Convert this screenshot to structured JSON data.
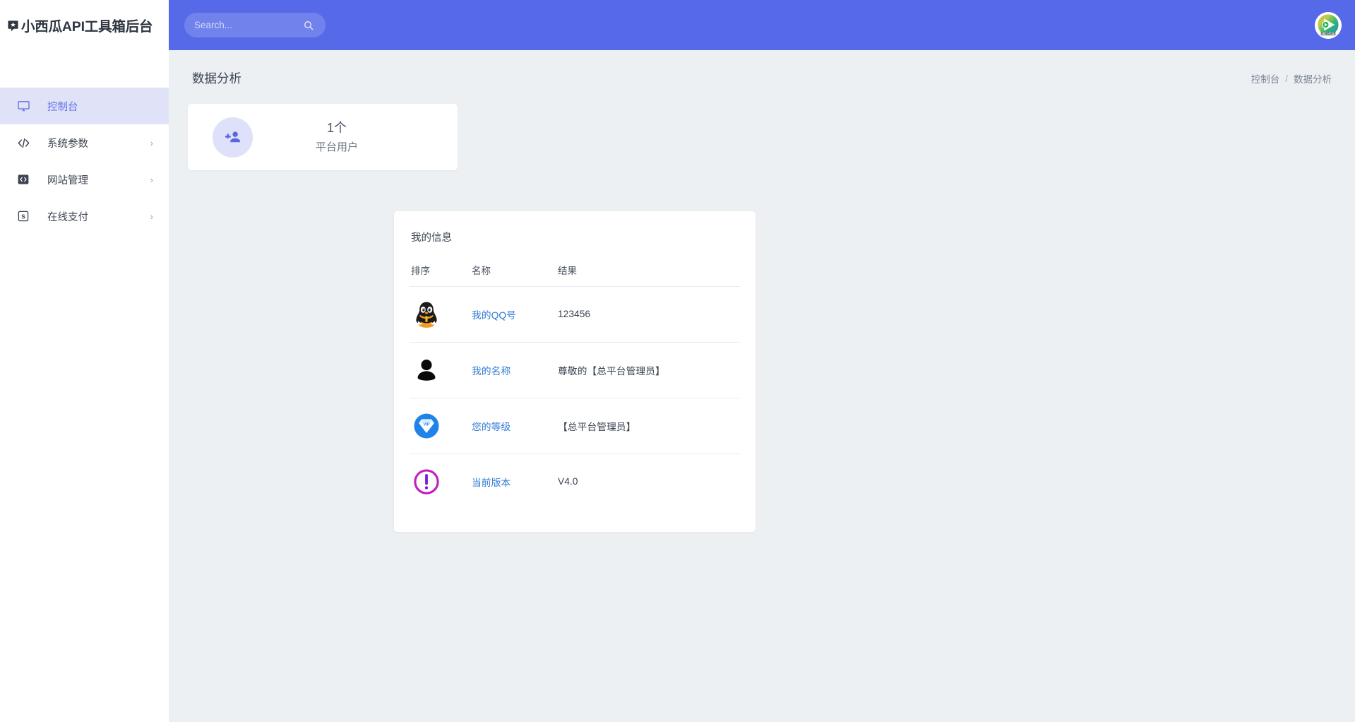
{
  "brand": {
    "title": "小西瓜API工具箱后台",
    "icon": "chat-star-icon"
  },
  "sidebar": {
    "items": [
      {
        "label": "控制台",
        "icon": "monitor-icon",
        "active": true,
        "has_arrow": false
      },
      {
        "label": "系统参数",
        "icon": "code-brackets-icon",
        "active": false,
        "has_arrow": true,
        "arrow": "›"
      },
      {
        "label": "网站管理",
        "icon": "code-box-filled-icon",
        "active": false,
        "has_arrow": true,
        "arrow": "›"
      },
      {
        "label": "在线支付",
        "icon": "currency-box-icon",
        "active": false,
        "has_arrow": true,
        "arrow": "›"
      }
    ]
  },
  "topbar": {
    "search": {
      "placeholder": "Search...",
      "value": "",
      "icon": "search-icon"
    },
    "avatar": {
      "icon": "tencent-video-play-avatar",
      "alt": "用户头像"
    },
    "background_color": "#5669e8"
  },
  "page": {
    "title": "数据分析",
    "breadcrumb": {
      "items": [
        "控制台",
        "数据分析"
      ],
      "separator": "/"
    }
  },
  "stat_card": {
    "icon": "person-add-icon",
    "value": "1个",
    "label": "平台用户",
    "icon_color": "#5a67e0",
    "icon_bg": "#dfe1fa"
  },
  "info_card": {
    "title": "我的信息",
    "columns": [
      "排序",
      "名称",
      "结果"
    ],
    "rows": [
      {
        "icon": "qq-penguin-icon",
        "name": "我的QQ号",
        "result": "123456"
      },
      {
        "icon": "user-silhouette-icon",
        "name": "我的名称",
        "result": "尊敬的【总平台管理员】"
      },
      {
        "icon": "vip-diamond-icon",
        "name": "您的等级",
        "result": "【总平台管理员】"
      },
      {
        "icon": "exclamation-circle-icon",
        "name": "当前版本",
        "result": "V4.0"
      }
    ]
  },
  "colors": {
    "accent": "#5669e8",
    "active_nav_bg": "#e0e2f8",
    "active_nav_text": "#6170e6",
    "content_bg": "#edf0f3",
    "link": "#2f7bd6"
  }
}
